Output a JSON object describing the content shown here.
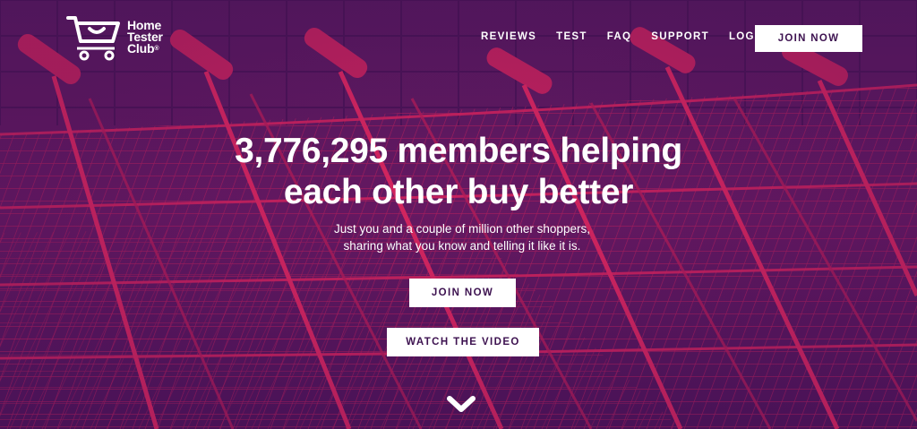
{
  "brand": {
    "logo_lines": [
      "Home",
      "Tester",
      "Club"
    ],
    "registered": "®"
  },
  "nav": {
    "items": [
      "REVIEWS",
      "TEST",
      "FAQ",
      "SUPPORT",
      "LOGIN"
    ],
    "join_label": "JOIN NOW"
  },
  "hero": {
    "headline_line1": "3,776,295 members helping",
    "headline_line2": "each other buy better",
    "sub_line1": "Just you and a couple of million other shoppers,",
    "sub_line2": "sharing what you know and telling it like it is.",
    "join_label": "JOIN NOW",
    "video_label": "WATCH THE VIDEO"
  },
  "icons": {
    "logo": "shopping-cart-icon",
    "scroll": "chevron-down-icon"
  },
  "colors": {
    "background": "#4a1557",
    "cart_wire": "#e8265e",
    "button_text": "#3d1250",
    "white": "#ffffff"
  }
}
